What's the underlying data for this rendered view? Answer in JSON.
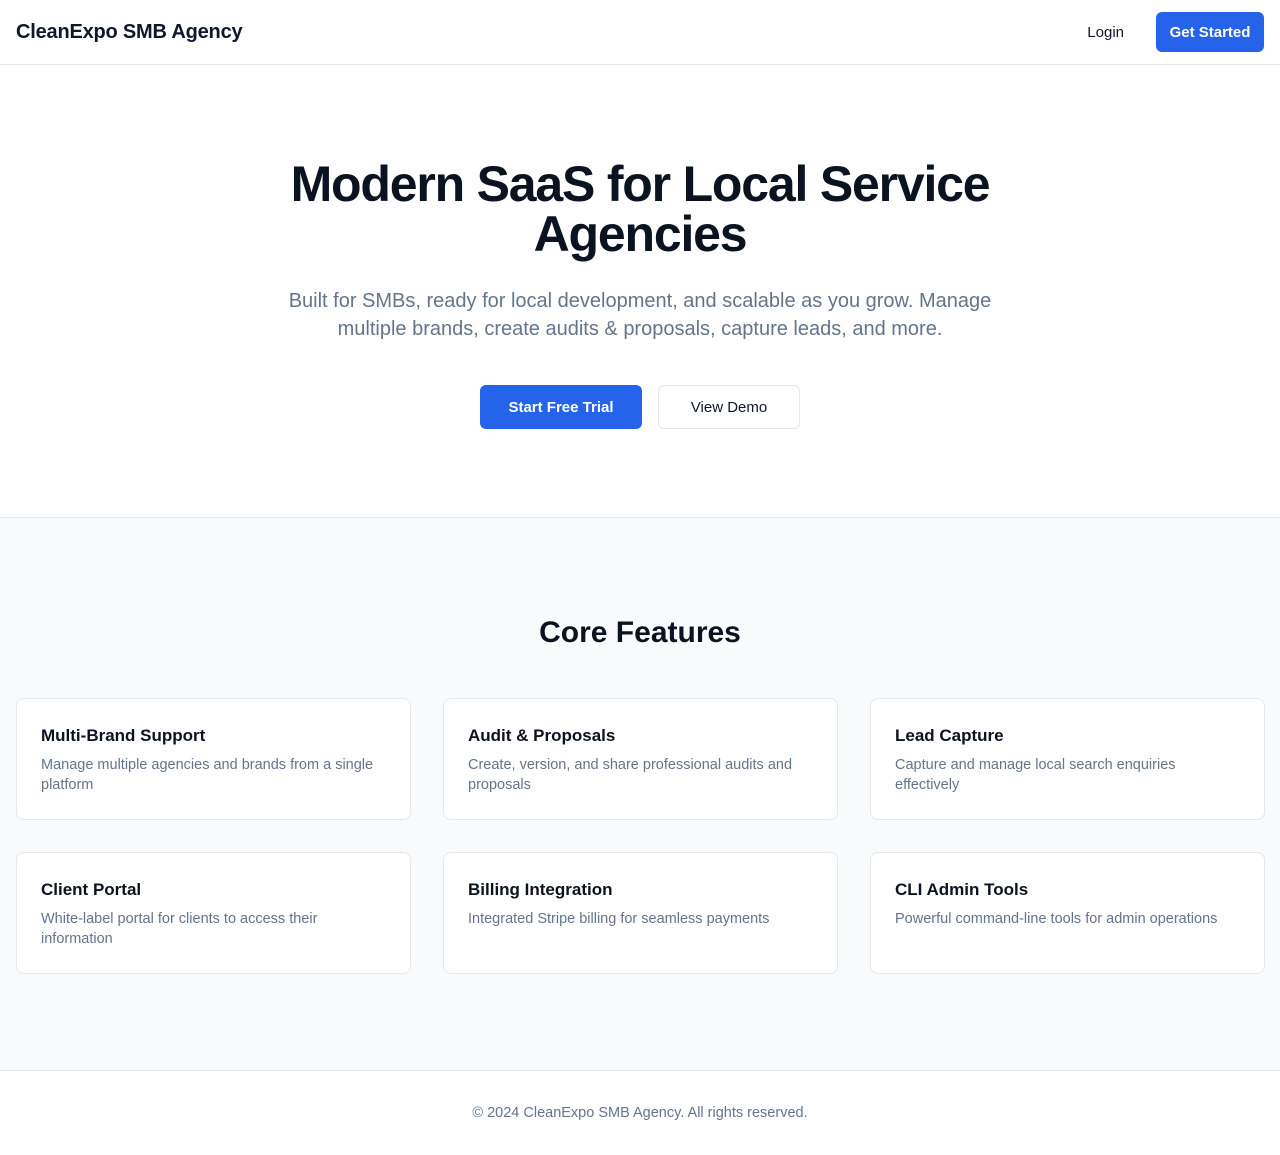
{
  "header": {
    "brand": "CleanExpo SMB Agency",
    "login_label": "Login",
    "get_started_label": "Get Started"
  },
  "hero": {
    "title": "Modern SaaS for Local Service Agencies",
    "subtitle": "Built for SMBs, ready for local development, and scalable as you grow. Manage multiple brands, create audits & proposals, capture leads, and more.",
    "primary_cta": "Start Free Trial",
    "secondary_cta": "View Demo"
  },
  "features": {
    "title": "Core Features",
    "items": [
      {
        "title": "Multi-Brand Support",
        "description": "Manage multiple agencies and brands from a single platform"
      },
      {
        "title": "Audit & Proposals",
        "description": "Create, version, and share professional audits and proposals"
      },
      {
        "title": "Lead Capture",
        "description": "Capture and manage local search enquiries effectively"
      },
      {
        "title": "Client Portal",
        "description": "White-label portal for clients to access their information"
      },
      {
        "title": "Billing Integration",
        "description": "Integrated Stripe billing for seamless payments"
      },
      {
        "title": "CLI Admin Tools",
        "description": "Powerful command-line tools for admin operations"
      }
    ]
  },
  "footer": {
    "copyright": "© 2024 CleanExpo SMB Agency. All rights reserved."
  },
  "colors": {
    "accent": "#2563eb",
    "heading": "#0b1220",
    "muted_text": "#64748b",
    "border": "#e5e7eb",
    "section_bg": "#f8fafc"
  }
}
